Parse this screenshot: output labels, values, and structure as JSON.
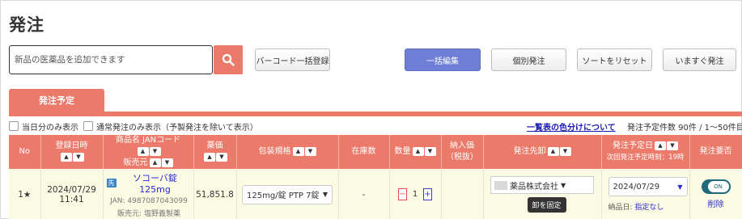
{
  "page": {
    "title": "発注"
  },
  "search": {
    "placeholder": "新品の医薬品を追加できます",
    "value": ""
  },
  "toolbar": {
    "barcode_label": "バーコード一括登録",
    "bulk_edit_label": "一括編集",
    "individual_order_label": "個別発注",
    "reset_sort_label": "ソートをリセット",
    "order_now_label": "いますぐ発注"
  },
  "tabs": [
    {
      "label": "発注予定",
      "active": true
    }
  ],
  "filters": {
    "today_only": {
      "label": "当日分のみ表示",
      "checked": false
    },
    "normal_only": {
      "label": "通常発注のみ表示（予製発注を除いて表示）",
      "checked": false
    }
  },
  "legend_link": "一覧表の色分けについて",
  "count_text": "発注予定件数 90件 / 1～50件目",
  "sort_icons": {
    "up": "▲",
    "down": "▼"
  },
  "table": {
    "headers": {
      "no": "No",
      "registered": "登録日時",
      "product_line1": "商品名 JANコード",
      "product_line2": "販売元",
      "price": "薬価",
      "package": "包装規格",
      "stock": "在庫数",
      "quantity": "数量",
      "delivery_price_line1": "納入価",
      "delivery_price_line2": "（税抜）",
      "supplier": "発注先卸",
      "scheduled_line1": "発注予定日",
      "scheduled_line2": "次回発注予定時刻：19時",
      "required": "発注要否"
    },
    "rows": [
      {
        "no": "1★",
        "date": "2024/07/29",
        "time": "11:41",
        "badge": "先",
        "product_name": "ソコーバ錠125mg",
        "jan": "JAN: 4987087043099",
        "maker": "販売元: 塩野義製薬",
        "price": "51,851.8",
        "package": "125mg/錠 PTP 7錠",
        "stock": "-",
        "quantity": "1",
        "minus": "−",
        "plus": "+",
        "delivery_price": "",
        "supplier": "薬品株式会社",
        "fix_label": "卸を固定",
        "scheduled_date": "2024/07/29",
        "delivery_label": "納品日:",
        "delivery_value": "指定なし",
        "toggle_label": "ON",
        "toggle_on": true,
        "delete_label": "削除"
      }
    ]
  },
  "colors": {
    "accent": "#ec7a6a",
    "primary_button": "#6f7fd6",
    "row_background": "#fbfbe3",
    "link": "#2a2ad0",
    "toggle": "#1e6a7a"
  },
  "icons": {
    "search": "search-icon",
    "dropdown": "chevron-down-icon",
    "star": "star-icon",
    "badge": "first-badge"
  }
}
